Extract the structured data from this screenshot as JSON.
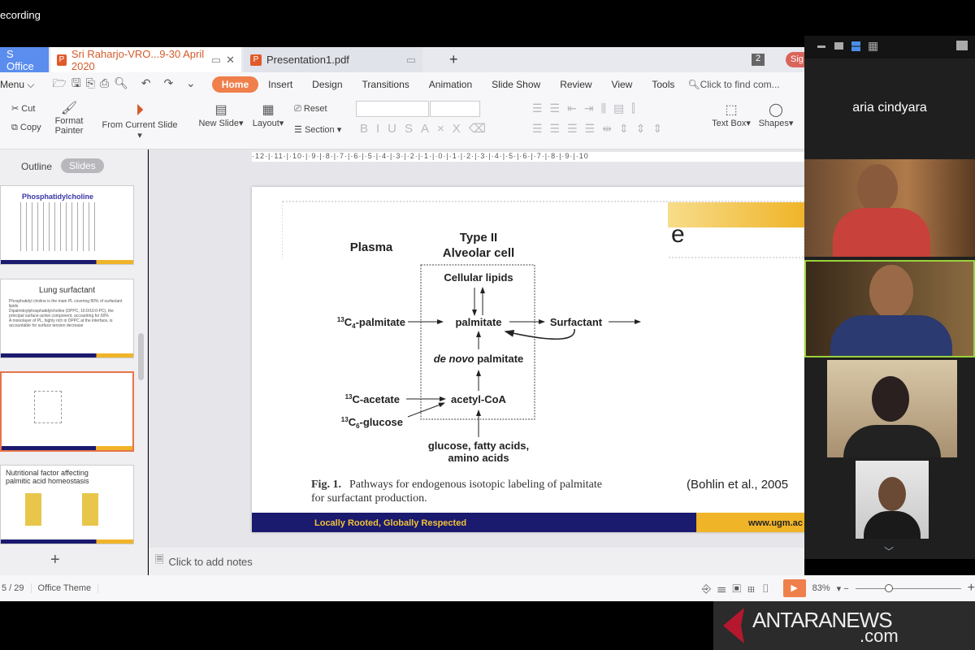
{
  "recording_label": "ecording",
  "tabs": {
    "app": "S Office",
    "active_doc": "Sri Raharjo-VRO...9-30 April 2020",
    "pdf_doc": "Presentation1.pdf",
    "new_tab": "+",
    "badge": "2",
    "sign_in": "Sig"
  },
  "menu": {
    "menu_label": "Menu",
    "items": [
      "Home",
      "Insert",
      "Design",
      "Transitions",
      "Animation",
      "Slide Show",
      "Review",
      "View",
      "Tools"
    ],
    "search_placeholder": "Click to find com..."
  },
  "ribbon": {
    "cut": "Cut",
    "copy": "Copy",
    "format_painter": "Format Painter",
    "from_current": "From Current Slide",
    "new_slide": "New Slide",
    "layout": "Layout",
    "reset": "Reset",
    "section": "Section",
    "text_box": "Text Box",
    "shapes": "Shapes"
  },
  "ruler": "·12·|·11·|·10·|·9·|·8·|·7·|·6·|·5·|·4·|·3·|·2·|·1·|·0·|·1·|·2·|·3·|·4·|·5·|·6·|·7·|·8·|·9·|·10",
  "left_panel": {
    "tabs": [
      "Outline",
      "Slides"
    ],
    "thumbs": [
      {
        "title": "Phosphatidylcholine"
      },
      {
        "title": "Lung surfactant",
        "bullets": [
          "Phosphatidyl choline is the main PL covering 80% of surfactant lipids",
          "Dipalmitoylphosphatidylcholine (DPPC, 16:0/16:0-PC), the principal surface-active component, accounting for 60%",
          "A monolayer of PL, highly rich in DPPC at the interface, is accountable for surface tension decrease"
        ]
      },
      {
        "title": ""
      },
      {
        "title": "Nutritional factor affecting palmitic acid homeostasis"
      }
    ],
    "add": "+"
  },
  "slide": {
    "title_fragment": "e",
    "plasma": "Plasma",
    "type2": "Type II",
    "alveolar": "Alveolar cell",
    "cellular_lipids": "Cellular lipids",
    "c4_palmitate": {
      "sup": "13",
      "c": "C",
      "sub": "4",
      "rest": "-palmitate"
    },
    "palmitate": "palmitate",
    "surfactant": "Surfactant",
    "de_novo": {
      "italic": "de novo",
      "rest": " palmitate"
    },
    "acetate": {
      "sup": "13",
      "rest": "C-acetate"
    },
    "acetyl_coa": "acetyl-CoA",
    "glucose6": {
      "sup": "13",
      "c": "C",
      "sub": "6",
      "rest": "-glucose"
    },
    "sources_1": "glucose, fatty acids,",
    "sources_2": "amino acids",
    "caption_label": "Fig. 1.",
    "caption_1": "Pathways for endogenous isotopic labeling of palmitate",
    "caption_2": "for surfactant production.",
    "citation": "(Bohlin et al., 2005",
    "footer_motto": "Locally Rooted, Globally Respected",
    "footer_url": "www.ugm.ac",
    "colors": {
      "navy": "#1a1a6e",
      "gold": "#f0b429"
    }
  },
  "notes_placeholder": "Click to add notes",
  "status": {
    "slide_counter": "5 / 29",
    "theme": "Office Theme",
    "zoom": "83%",
    "zoom_level_percent": 83
  },
  "video": {
    "speaker_name": "aria cindyara",
    "participants": 4
  },
  "watermark": {
    "brand": "ANTARANEWS",
    ".com": ".com"
  }
}
